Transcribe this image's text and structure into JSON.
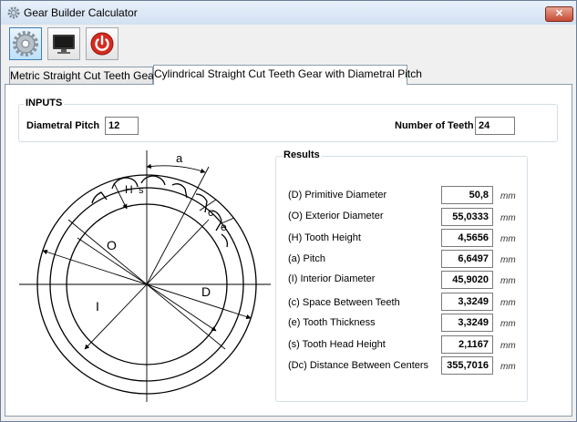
{
  "window": {
    "title": "Gear Builder Calculator",
    "close_label": "✕"
  },
  "toolbar": {
    "buttons": [
      "settings",
      "monitor",
      "power"
    ]
  },
  "tabs": [
    {
      "label": "Metric Straight Cut Teeth Gear",
      "active": false
    },
    {
      "label": "Cylindrical Straight Cut Teeth Gear with Diametral Pitch",
      "active": true
    }
  ],
  "inputs": {
    "title": "INPUTS",
    "diametral_pitch_label": "Diametral Pitch",
    "diametral_pitch_value": "12",
    "teeth_label": "Number of Teeth",
    "teeth_value": "24"
  },
  "diagram": {
    "labels": {
      "a": "a",
      "h": "H",
      "s": "s",
      "c": "c",
      "e": "e",
      "o": "O",
      "d": "D",
      "i": "I"
    }
  },
  "results": {
    "title": "Results",
    "unit": "mm",
    "rows": [
      {
        "label": "(D) Primitive Diameter",
        "value": "50,8"
      },
      {
        "label": "(O) Exterior Diameter",
        "value": "55,0333"
      },
      {
        "label": "(H) Tooth Height",
        "value": "4,5656"
      },
      {
        "label": "(a) Pitch",
        "value": "6,6497"
      },
      {
        "label": "(I) Interior Diameter",
        "value": "45,9020"
      },
      {
        "label": "(c) Space Between Teeth",
        "value": "3,3249"
      },
      {
        "label": "(e) Tooth Thickness",
        "value": "3,3249"
      },
      {
        "label": "(s) Tooth Head Height",
        "value": "2,1167"
      },
      {
        "label": "(Dc) Distance Between Centers",
        "value": "355,7016"
      }
    ]
  }
}
